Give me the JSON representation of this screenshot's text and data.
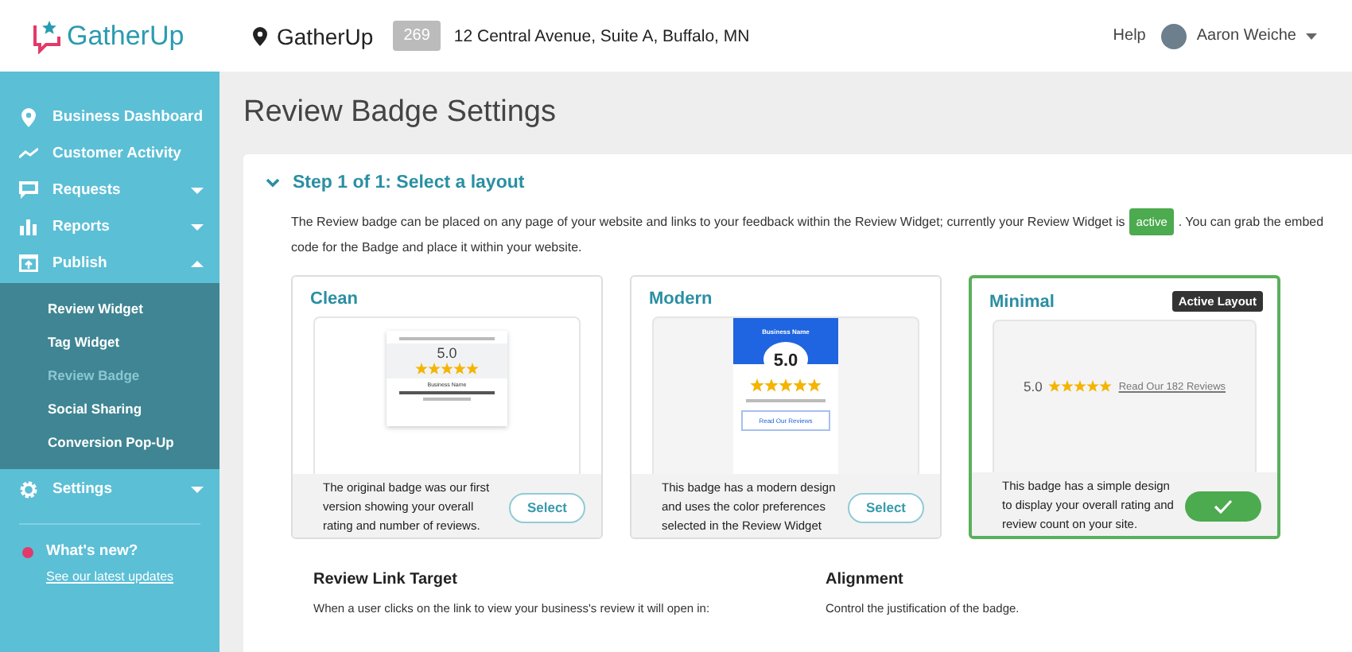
{
  "header": {
    "logo": "GatherUp",
    "location": {
      "name": "GatherUp",
      "count": "269",
      "address": "12 Central Avenue, Suite A, Buffalo, MN"
    },
    "help": "Help",
    "user": "Aaron Weiche"
  },
  "sidebar": {
    "items": [
      {
        "label": "Business Dashboard",
        "kind": "dashboard"
      },
      {
        "label": "Customer Activity",
        "kind": "activity"
      },
      {
        "label": "Requests",
        "kind": "requests",
        "expanded": false
      },
      {
        "label": "Reports",
        "kind": "reports",
        "expanded": false
      },
      {
        "label": "Publish",
        "kind": "publish",
        "expanded": true,
        "children": [
          {
            "label": "Review Widget",
            "selected": false
          },
          {
            "label": "Tag Widget",
            "selected": false
          },
          {
            "label": "Review Badge",
            "selected": true
          },
          {
            "label": "Social Sharing",
            "selected": false
          },
          {
            "label": "Conversion Pop-Up",
            "selected": false
          }
        ]
      },
      {
        "label": "Settings",
        "kind": "settings",
        "expanded": false
      }
    ],
    "news": {
      "title": "What's new?",
      "link": "See our latest updates"
    }
  },
  "page_title": "Review Badge Settings",
  "step": {
    "title": "Step 1 of 1: Select a layout",
    "expanded": true,
    "text_before": "The Review badge can be placed on any page of your website and links to your feedback within the Review Widget; currently your Review Widget is",
    "status": "active",
    "text_after": ". You can grab the embed",
    "text_line2": "code for the Badge and place it within your website.",
    "active_label": "Active Layout",
    "layouts": [
      {
        "kind": "clean",
        "name": "Clean",
        "selected": false,
        "description": "The original badge was our first version showing your overall rating and number of reviews.",
        "button": "Select",
        "preview": {
          "rating": "5.0",
          "business": "Business Name"
        }
      },
      {
        "kind": "modern",
        "name": "Modern",
        "selected": false,
        "description": "This badge has a modern design and uses the color preferences selected in the Review Widget",
        "button": "Select",
        "preview": {
          "business": "Business Name",
          "rating": "5.0",
          "link": "Read Our Reviews"
        }
      },
      {
        "kind": "minimal",
        "name": "Minimal",
        "selected": true,
        "description": "This badge has a simple design to display your overall rating and review count on your site.",
        "preview": {
          "rating": "5.0",
          "link": "Read Our 182 Reviews"
        }
      }
    ]
  },
  "sections": [
    {
      "title": "Review Link Target",
      "text": "When a user clicks on the link to view your business's review it will open in:"
    },
    {
      "title": "Alignment",
      "text": "Control the justification of the badge."
    }
  ]
}
